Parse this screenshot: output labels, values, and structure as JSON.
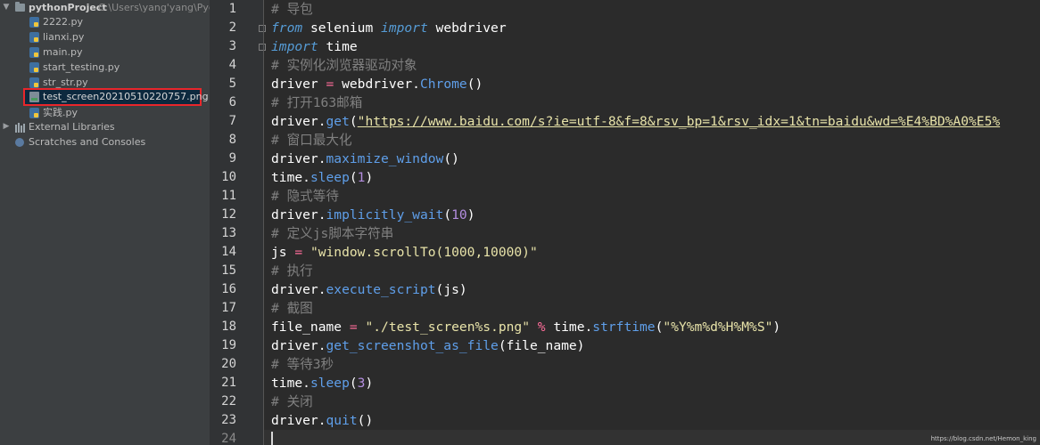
{
  "project_tree": {
    "root_name": "pythonProject",
    "root_path": "C:\\Users\\yang'yang\\Pycha",
    "files": [
      {
        "name": "2222.py",
        "type": "py"
      },
      {
        "name": "lianxi.py",
        "type": "py"
      },
      {
        "name": "main.py",
        "type": "py"
      },
      {
        "name": "start_testing.py",
        "type": "py"
      },
      {
        "name": "str_str.py",
        "type": "py"
      },
      {
        "name": "test_screen20210510220757.png",
        "type": "png",
        "selected": true
      },
      {
        "name": "实践.py",
        "type": "py"
      }
    ],
    "external_libraries": "External Libraries",
    "scratches": "Scratches and Consoles"
  },
  "editor": {
    "line_numbers": [
      "1",
      "2",
      "3",
      "4",
      "5",
      "6",
      "7",
      "8",
      "9",
      "10",
      "11",
      "12",
      "13",
      "14",
      "15",
      "16",
      "17",
      "18",
      "19",
      "20",
      "21",
      "22",
      "23",
      "24"
    ],
    "code": {
      "l1_comment": "# 导包",
      "l2_from": "from",
      "l2_mod": " selenium ",
      "l2_import": "import",
      "l2_name": " webdriver",
      "l3_import": "import",
      "l3_name": " time",
      "l4_comment": "# 实例化浏览器驱动对象",
      "l5_a": "driver ",
      "l5_eq": "=",
      "l5_b": " webdriver.",
      "l5_fn": "Chrome",
      "l5_c": "()",
      "l6_comment": "# 打开163邮箱",
      "l7_a": "driver.",
      "l7_fn": "get",
      "l7_b": "(",
      "l7_str": "\"https://www.baidu.com/s?ie=utf-8&f=8&rsv_bp=1&rsv_idx=1&tn=baidu&wd=%E4%BD%A0%E5%",
      "l8_comment": "# 窗口最大化",
      "l9_a": "driver.",
      "l9_fn": "maximize_window",
      "l9_b": "()",
      "l10_a": "time.",
      "l10_fn": "sleep",
      "l10_b": "(",
      "l10_num": "1",
      "l10_c": ")",
      "l11_comment": "# 隐式等待",
      "l12_a": "driver.",
      "l12_fn": "implicitly_wait",
      "l12_b": "(",
      "l12_num": "10",
      "l12_c": ")",
      "l13_comment": "# 定义js脚本字符串",
      "l14_a": "js ",
      "l14_eq": "=",
      "l14_sp": " ",
      "l14_str": "\"window.scrollTo(1000,10000)\"",
      "l15_comment": "# 执行",
      "l16_a": "driver.",
      "l16_fn": "execute_script",
      "l16_b": "(js)",
      "l17_comment": "# 截图",
      "l18_a": "file_name ",
      "l18_eq": "=",
      "l18_sp": " ",
      "l18_str": "\"./test_screen%s.png\"",
      "l18_sp2": " ",
      "l18_op": "%",
      "l18_b": " time.",
      "l18_fn": "strftime",
      "l18_c": "(",
      "l18_str2": "\"%Y%m%d%H%M%S\"",
      "l18_d": ")",
      "l19_a": "driver.",
      "l19_fn": "get_screenshot_as_file",
      "l19_b": "(file_name)",
      "l20_comment": "# 等待3秒",
      "l21_a": "time.",
      "l21_fn": "sleep",
      "l21_b": "(",
      "l21_num": "3",
      "l21_c": ")",
      "l22_comment": "# 关闭",
      "l23_a": "driver.",
      "l23_fn": "quit",
      "l23_b": "()"
    }
  },
  "watermark": "https://blog.csdn.net/Hemon_king",
  "colors": {
    "sidebar_bg": "#3c3f41",
    "editor_bg": "#2b2b2b",
    "gutter_bg": "#313335",
    "selection_highlight": "#e8262b",
    "comment": "#808080",
    "keyword": "#569cd6",
    "function": "#5f9fea",
    "string": "#e8e3a9",
    "number": "#b48ee0",
    "operator": "#ff6d9a"
  }
}
